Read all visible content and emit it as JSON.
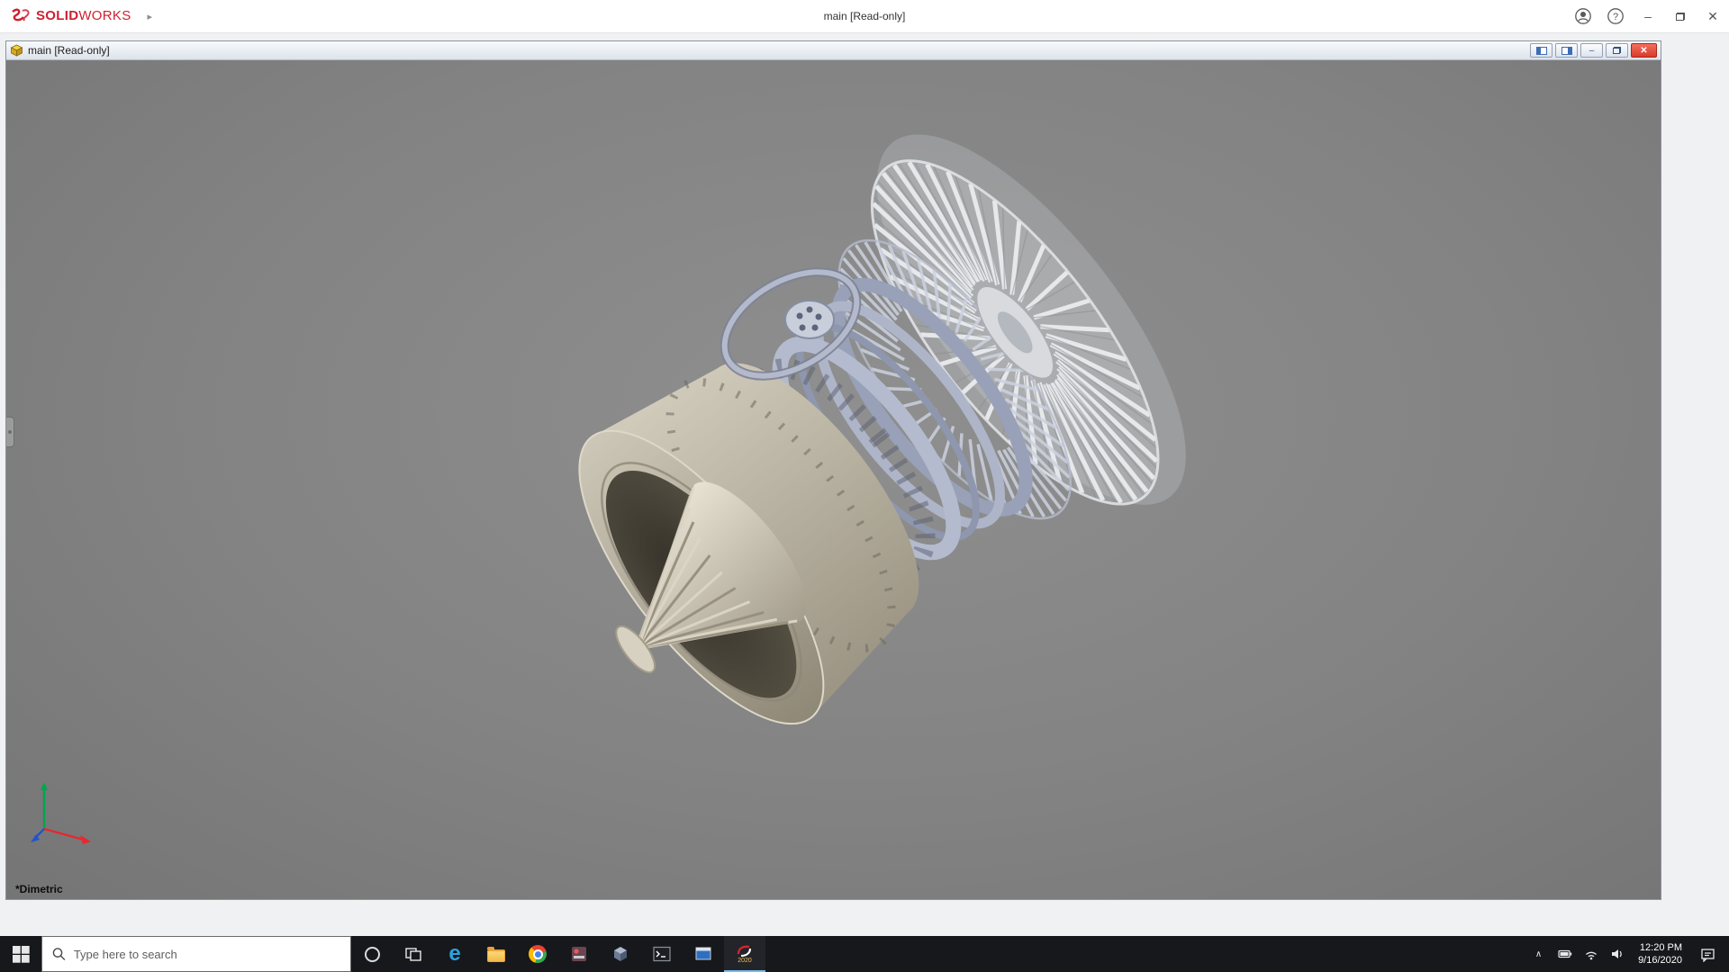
{
  "app": {
    "brand_solid": "SOLID",
    "brand_works": "WORKS",
    "title": "main [Read-only]"
  },
  "document_window": {
    "title": "main [Read-only]",
    "view_label": "*Dimetric"
  },
  "viewport": {
    "model": "jet-engine-assembly",
    "background": "#828282"
  },
  "icons": {
    "menu_expand": "▸",
    "minimize": "–",
    "close": "✕",
    "help": "?",
    "tray_chevron": "∧"
  },
  "taskbar": {
    "search_placeholder": "Type here to search",
    "solidworks_badge": "2020",
    "clock_time": "12:20 PM",
    "clock_date": "9/16/2020",
    "pinned_apps": [
      "start",
      "search",
      "cortana",
      "task-view",
      "edge",
      "file-explorer",
      "chrome",
      "media-app",
      "cube-app",
      "terminal",
      "window-app",
      "solidworks"
    ],
    "tray_items": [
      "hidden-icons",
      "battery",
      "network",
      "volume",
      "clock",
      "notifications",
      "show-desktop"
    ]
  },
  "colors": {
    "brand_red": "#cf1f2f",
    "close_red": "#d83a2b",
    "taskbar_bg": "#17181c",
    "viewport_gray": "#828282",
    "engine_tan": "#b8b2a2",
    "engine_blue": "#a9b2c8",
    "triad_x": "#e8282d",
    "triad_y": "#00a650",
    "triad_z": "#2255cc"
  }
}
